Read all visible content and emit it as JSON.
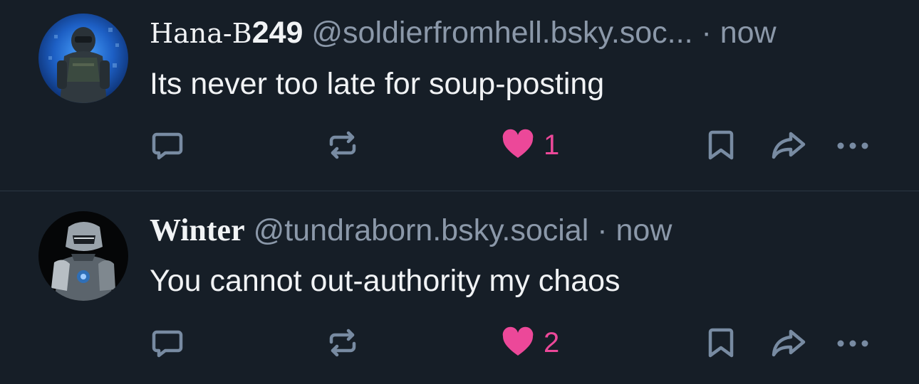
{
  "colors": {
    "background": "#161e27",
    "text_primary": "#f1f3f5",
    "text_secondary": "#8b98a9",
    "like_active": "#ec4899",
    "icon": "#788ba2",
    "divider": "#2c3744"
  },
  "icons": {
    "reply": "speech-bubble-icon",
    "repost": "repost-arrows-icon",
    "like": "heart-icon",
    "bookmark": "bookmark-icon",
    "share": "share-arrow-icon",
    "more": "ellipsis-icon"
  },
  "posts": [
    {
      "display_name_prefix": "Hana-B",
      "display_name_suffix": "249",
      "handle": "@soldierfromhell.bsky.soc...",
      "separator": "·",
      "time": "now",
      "text": "Its never too late for soup-posting",
      "like_count": "1",
      "liked": true
    },
    {
      "display_name": "Winter",
      "handle": "@tundraborn.bsky.social",
      "separator": "·",
      "time": "now",
      "text": "You cannot out-authority my chaos",
      "like_count": "2",
      "liked": true
    }
  ]
}
